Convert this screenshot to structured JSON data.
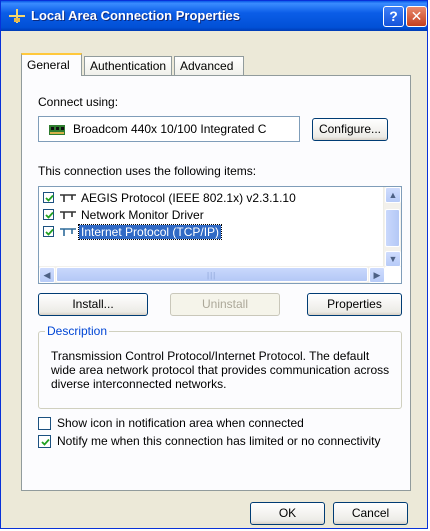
{
  "window": {
    "title": "Local Area Connection Properties",
    "help_label": "?",
    "close_label": "✕"
  },
  "tabs": [
    {
      "label": "General",
      "active": true
    },
    {
      "label": "Authentication",
      "active": false
    },
    {
      "label": "Advanced",
      "active": false
    }
  ],
  "connect_using": {
    "label": "Connect using:",
    "device": "Broadcom 440x 10/100 Integrated C",
    "configure_button": "Configure..."
  },
  "items_section": {
    "label": "This connection uses the following items:",
    "items": [
      {
        "label": "AEGIS Protocol (IEEE 802.1x) v2.3.1.10",
        "checked": true,
        "selected": false
      },
      {
        "label": "Network Monitor Driver",
        "checked": true,
        "selected": false
      },
      {
        "label": "Internet Protocol (TCP/IP)",
        "checked": true,
        "selected": true
      }
    ]
  },
  "buttons": {
    "install": "Install...",
    "uninstall": "Uninstall",
    "properties": "Properties",
    "ok": "OK",
    "cancel": "Cancel"
  },
  "description": {
    "title": "Description",
    "text": "Transmission Control Protocol/Internet Protocol. The default wide area network protocol that provides communication across diverse interconnected networks."
  },
  "options": {
    "show_icon": {
      "label": "Show icon in notification area when connected",
      "checked": false
    },
    "notify_me": {
      "label": "Notify me when this connection has limited or no connectivity",
      "checked": true
    }
  },
  "colors": {
    "titlebar": "#0054e3",
    "selection": "#316ac5",
    "dialog_bg": "#ece9d8",
    "group_title": "#0046d5"
  }
}
